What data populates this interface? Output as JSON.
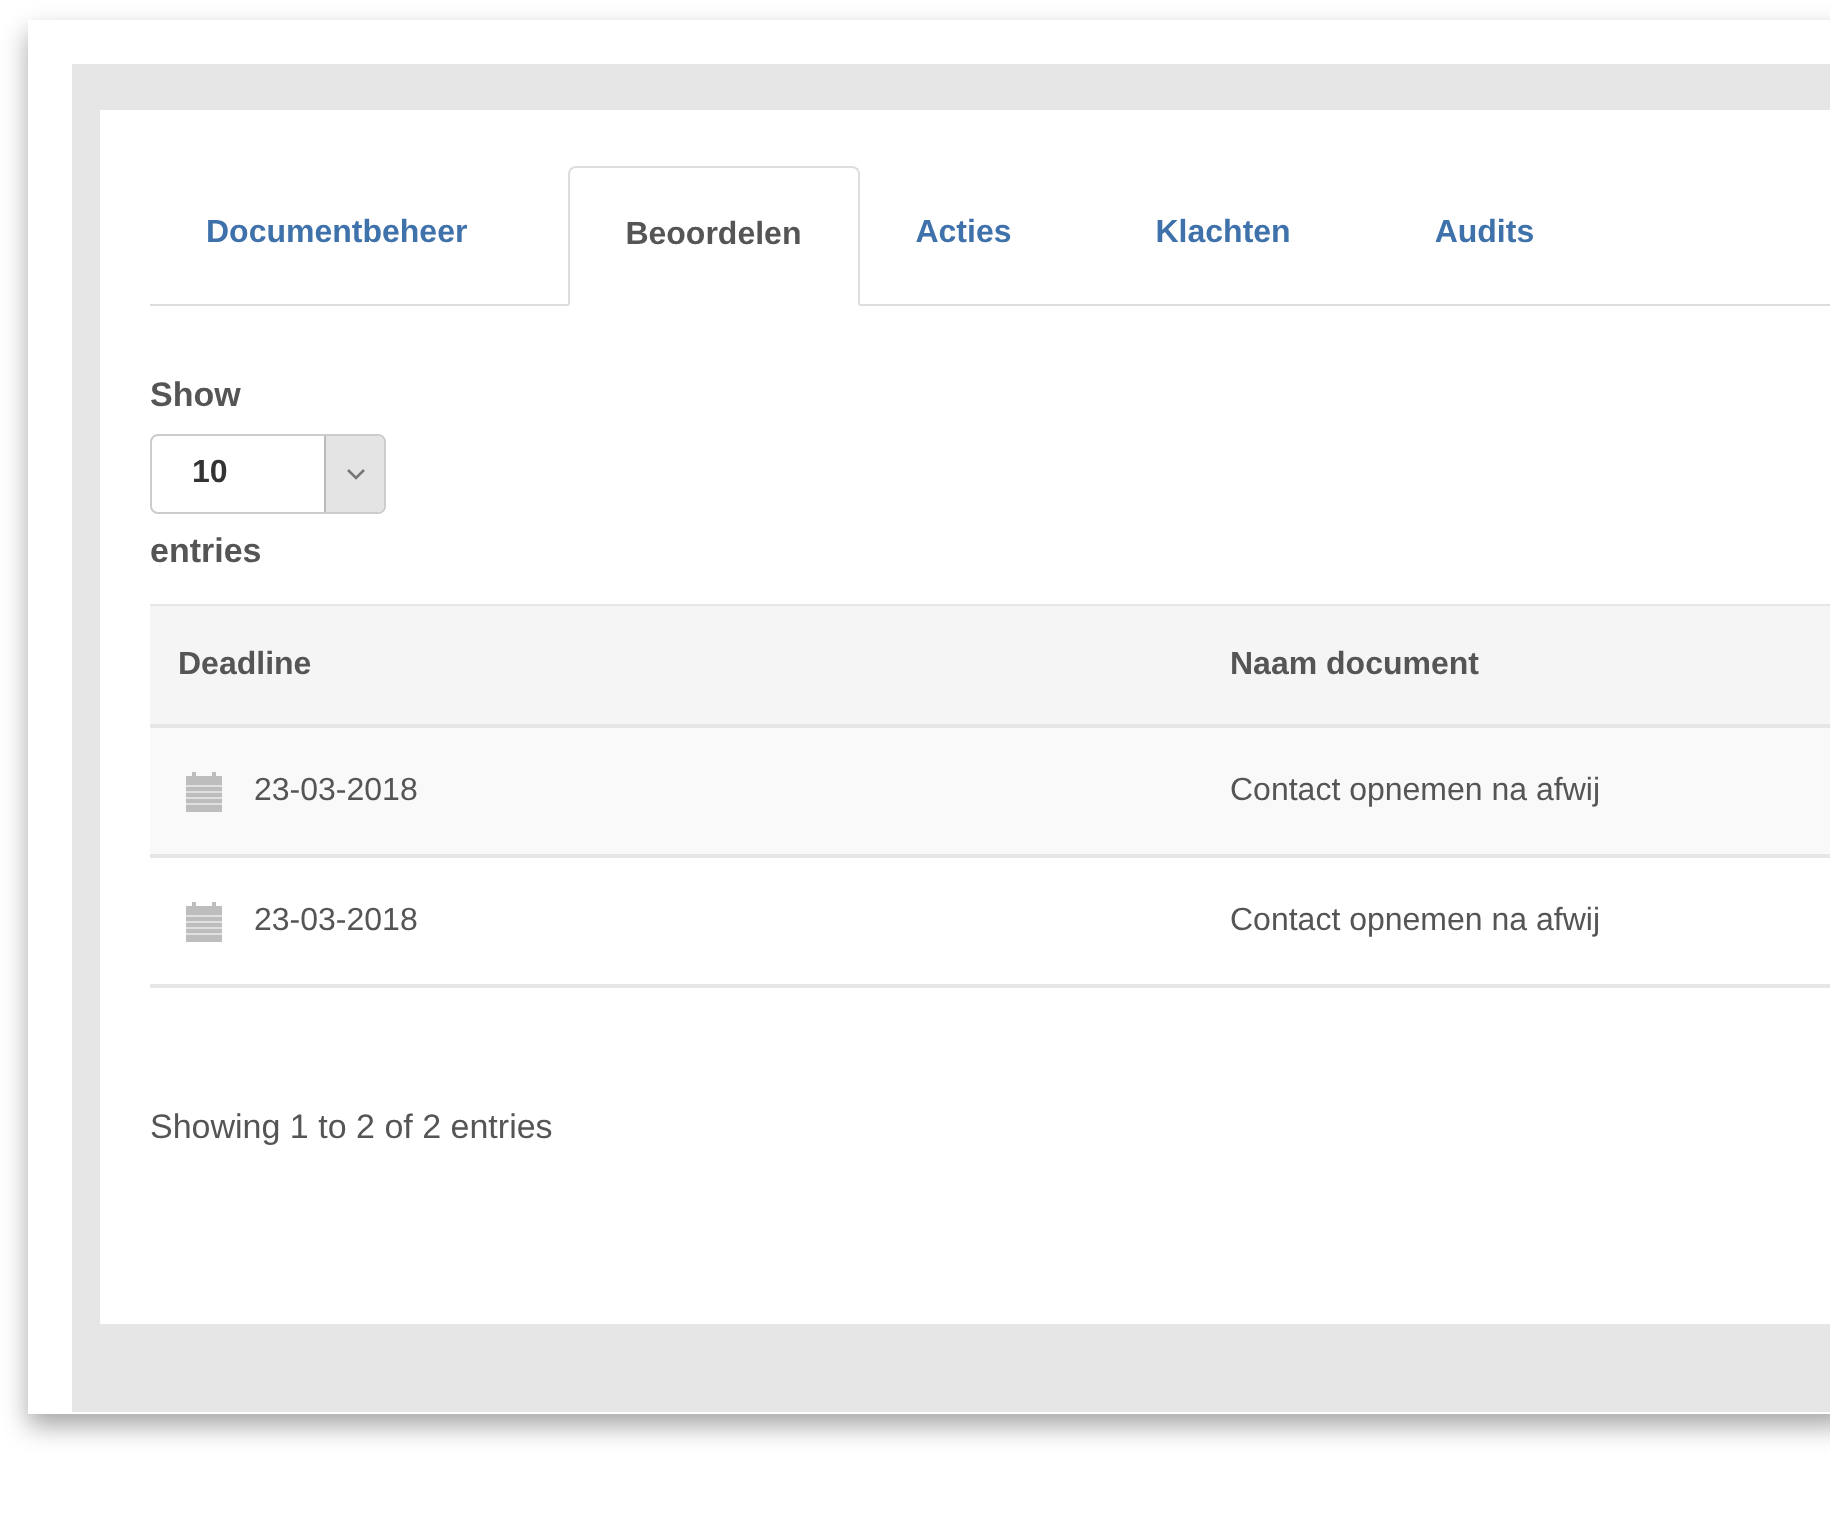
{
  "tabs": [
    {
      "label": "Documentbeheer",
      "selected": false
    },
    {
      "label": "Beoordelen",
      "selected": true
    },
    {
      "label": "Acties",
      "selected": false
    },
    {
      "label": "Klachten",
      "selected": false
    },
    {
      "label": "Audits",
      "selected": false
    }
  ],
  "length_menu": {
    "label_before": "Show",
    "value": "10",
    "label_after": "entries"
  },
  "table": {
    "columns": [
      "Deadline",
      "Naam document"
    ],
    "rows": [
      {
        "deadline": "23-03-2018",
        "naam_document": "Contact opnemen na afwij"
      },
      {
        "deadline": "23-03-2018",
        "naam_document": "Contact opnemen na afwij"
      }
    ]
  },
  "info": "Showing 1 to 2 of 2 entries"
}
